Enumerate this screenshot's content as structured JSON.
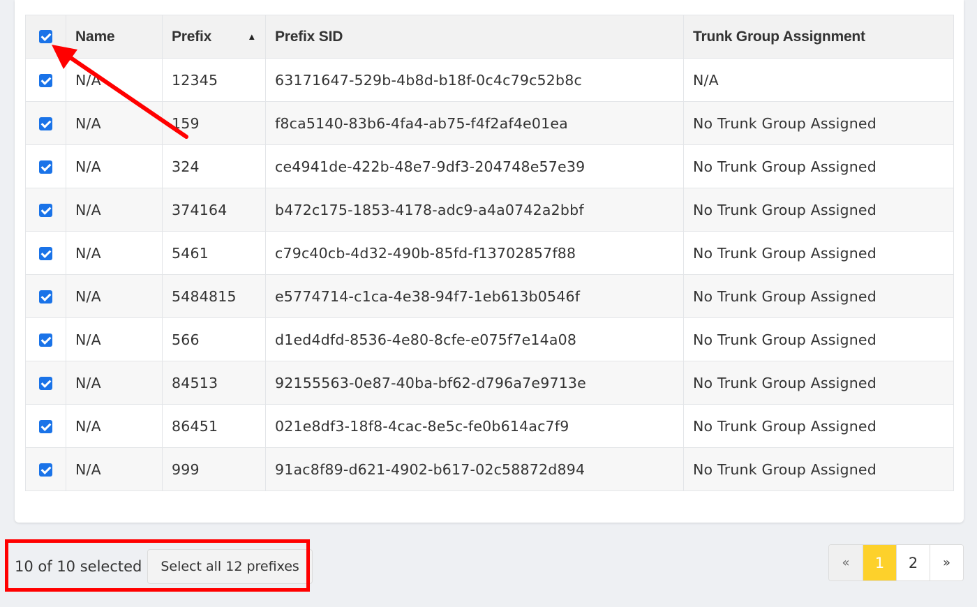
{
  "table": {
    "headers": {
      "name": "Name",
      "prefix": "Prefix",
      "prefix_sid": "Prefix SID",
      "trunk_group": "Trunk Group Assignment"
    },
    "sort_icon": "▲",
    "rows": [
      {
        "name": "N/A",
        "prefix": "12345",
        "sid": "63171647-529b-4b8d-b18f-0c4c79c52b8c",
        "trunk": "N/A"
      },
      {
        "name": "N/A",
        "prefix": "159",
        "sid": "f8ca5140-83b6-4fa4-ab75-f4f2af4e01ea",
        "trunk": "No Trunk Group Assigned"
      },
      {
        "name": "N/A",
        "prefix": "324",
        "sid": "ce4941de-422b-48e7-9df3-204748e57e39",
        "trunk": "No Trunk Group Assigned"
      },
      {
        "name": "N/A",
        "prefix": "374164",
        "sid": "b472c175-1853-4178-adc9-a4a0742a2bbf",
        "trunk": "No Trunk Group Assigned"
      },
      {
        "name": "N/A",
        "prefix": "5461",
        "sid": "c79c40cb-4d32-490b-85fd-f13702857f88",
        "trunk": "No Trunk Group Assigned"
      },
      {
        "name": "N/A",
        "prefix": "5484815",
        "sid": "e5774714-c1ca-4e38-94f7-1eb613b0546f",
        "trunk": "No Trunk Group Assigned"
      },
      {
        "name": "N/A",
        "prefix": "566",
        "sid": "d1ed4dfd-8536-4e80-8cfe-e075f7e14a08",
        "trunk": "No Trunk Group Assigned"
      },
      {
        "name": "N/A",
        "prefix": "84513",
        "sid": "92155563-0e87-40ba-bf62-d796a7e9713e",
        "trunk": "No Trunk Group Assigned"
      },
      {
        "name": "N/A",
        "prefix": "86451",
        "sid": "021e8df3-18f8-4cac-8e5c-fe0b614ac7f9",
        "trunk": "No Trunk Group Assigned"
      },
      {
        "name": "N/A",
        "prefix": "999",
        "sid": "91ac8f89-d621-4902-b617-02c58872d894",
        "trunk": "No Trunk Group Assigned"
      }
    ]
  },
  "selection": {
    "count_text": "10 of 10 selected",
    "select_all_label": "Select all 12 prefixes"
  },
  "pagination": {
    "prev": "«",
    "pages": [
      "1",
      "2"
    ],
    "active_page": "1",
    "next": "»"
  },
  "colors": {
    "checkbox": "#1a73e8",
    "active_page": "#fdd12b",
    "annotation": "#ff0000"
  }
}
